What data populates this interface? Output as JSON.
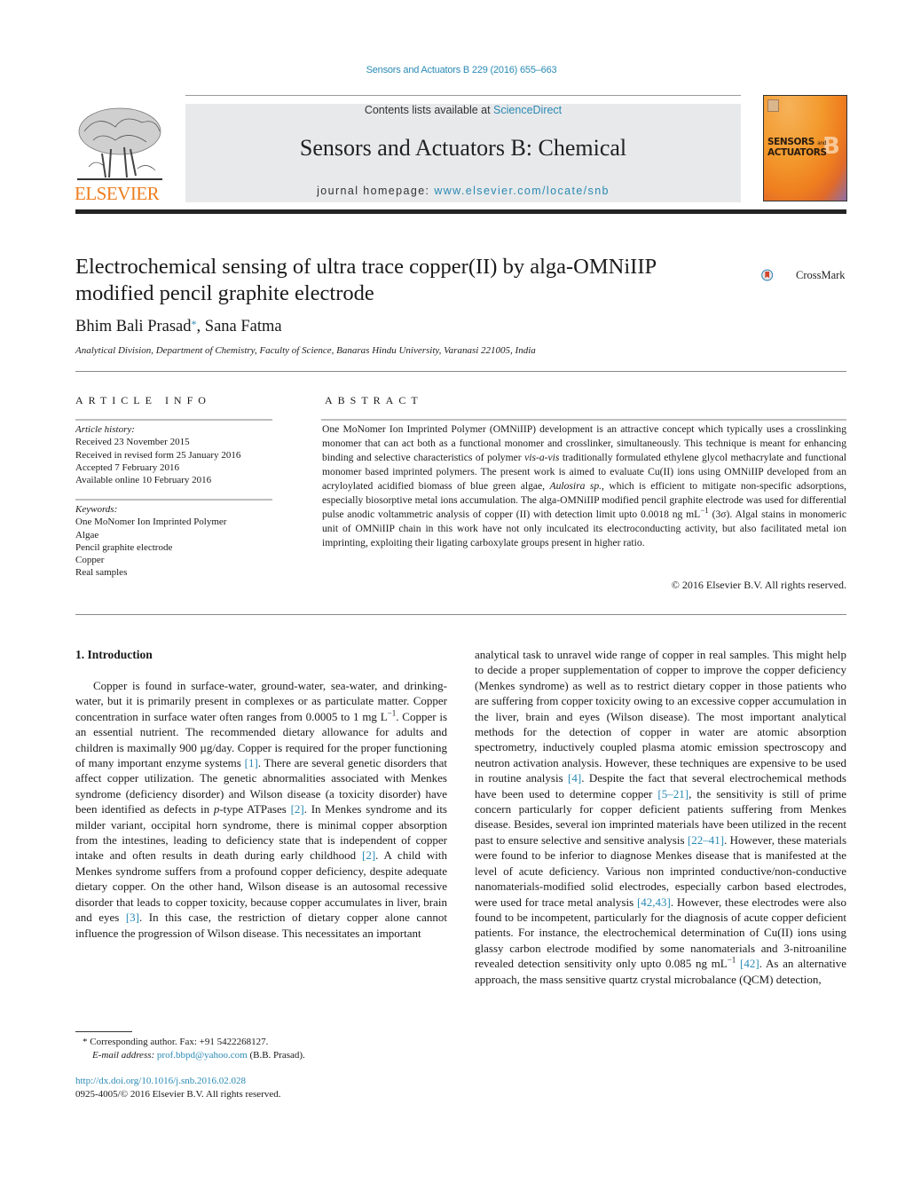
{
  "header": {
    "citation": "Sensors and Actuators B 229 (2016) 655–663",
    "contents_prefix": "Contents lists available at ",
    "contents_link": "ScienceDirect",
    "journal_title": "Sensors and Actuators B: Chemical",
    "homepage_prefix": "journal homepage: ",
    "homepage_link": "www.elsevier.com/locate/snb",
    "publisher_logo_text": "ELSEVIER",
    "cover_title_line1": "SENSORS",
    "cover_title_and": "and",
    "cover_title_line2": "ACTUATORS",
    "cover_letter": "B",
    "crossmark_label": "CrossMark"
  },
  "article": {
    "title": "Electrochemical sensing of ultra trace copper(II) by alga-OMNiIIP modified pencil graphite electrode",
    "authors": [
      {
        "name": "Bhim Bali Prasad",
        "corresponding_mark": "*"
      },
      {
        "name": "Sana Fatma"
      }
    ],
    "author_separator": ", ",
    "affiliation": "Analytical Division, Department of Chemistry, Faculty of Science, Banaras Hindu University, Varanasi 221005, India"
  },
  "article_info": {
    "heading": "ARTICLE INFO",
    "history_label": "Article history:",
    "history": [
      "Received 23 November 2015",
      "Received in revised form 25 January 2016",
      "Accepted 7 February 2016",
      "Available online 10 February 2016"
    ],
    "keywords_label": "Keywords:",
    "keywords": [
      "One MoNomer Ion Imprinted Polymer",
      "Algae",
      "Pencil graphite electrode",
      "Copper",
      "Real samples"
    ]
  },
  "abstract": {
    "heading": "ABSTRACT",
    "p1": "One MoNomer Ion Imprinted Polymer (OMNiIIP) development is an attractive concept which typically uses a crosslinking monomer that can act both as a functional monomer and crosslinker, simultaneously. This technique is meant for enhancing binding and selective characteristics of polymer ",
    "p1_italic": "vis-a-vis",
    "p2": " traditionally formulated ethylene glycol methacrylate and functional monomer based imprinted polymers. The present work is aimed to evaluate Cu(II) ions using OMNiIIP developed from an acryloylated acidified biomass of blue green algae, ",
    "p2_italic": "Aulosira sp.",
    "p3": ", which is efficient to mitigate non-specific adsorptions, especially biosorptive metal ions accumulation. The alga-OMNiIIP modified pencil graphite electrode was used for differential pulse anodic voltammetric analysis of copper (II) with detection limit upto 0.0018 ng mL",
    "p3_sup": "−1",
    "p4": " (3σ). Algal stains in monomeric unit of OMNiIIP chain in this work have not only inculcated its electroconducting activity, but also facilitated metal ion imprinting, exploiting their ligating carboxylate groups present in higher ratio.",
    "copyright": "© 2016 Elsevier B.V. All rights reserved."
  },
  "introduction": {
    "heading": "1.  Introduction",
    "left": [
      {
        "t": "Copper is found in surface-water, ground-water, sea-water, and drinking-water, but it is primarily present in complexes or as particulate matter. Copper concentration in surface water often ranges from 0.0005 to 1 mg L"
      },
      {
        "sup": "−1"
      },
      {
        "t": ". Copper is an essential nutrient. The recommended dietary allowance for adults and children is maximally 900 µg/day. Copper is required for the proper functioning of many important enzyme systems "
      },
      {
        "ref": "[1]"
      },
      {
        "t": ". There are several genetic disorders that affect copper utilization. The genetic abnormalities associated with Menkes syndrome (deficiency disorder) and Wilson disease (a toxicity disorder) have been identified as defects in "
      },
      {
        "it": "p"
      },
      {
        "t": "-type ATPases "
      },
      {
        "ref": "[2]"
      },
      {
        "t": ". In Menkes syndrome and its milder variant, occipital horn syndrome, there is minimal copper absorption from the intestines, leading to deficiency state that is independent of copper intake and often results in death during early childhood "
      },
      {
        "ref": "[2]"
      },
      {
        "t": ". A child with Menkes syndrome suffers from a profound copper deficiency, despite adequate dietary copper. On the other hand, Wilson disease is an autosomal recessive disorder that leads to copper toxicity, because copper accumulates in liver, brain and eyes "
      },
      {
        "ref": "[3]"
      },
      {
        "t": ". In this case, the restriction of dietary copper alone cannot influence the progression of Wilson disease. This necessitates an important"
      }
    ],
    "right": [
      {
        "t": "analytical task to unravel wide range of copper in real samples. This might help to decide a proper supplementation of copper to improve the copper deficiency (Menkes syndrome) as well as to restrict dietary copper in those patients who are suffering from copper toxicity owing to an excessive copper accumulation in the liver, brain and eyes (Wilson disease). The most important analytical methods for the detection of copper in water are atomic absorption spectrometry, inductively coupled plasma atomic emission spectroscopy and neutron activation analysis. However, these techniques are expensive to be used in routine analysis "
      },
      {
        "ref": "[4]"
      },
      {
        "t": ". Despite the fact that several electrochemical methods have been used to determine copper "
      },
      {
        "ref": "[5–21]"
      },
      {
        "t": ", the sensitivity is still of prime concern particularly for copper deficient patients suffering from Menkes disease. Besides, several ion imprinted materials have been utilized in the recent past to ensure selective and sensitive analysis "
      },
      {
        "ref": "[22–41]"
      },
      {
        "t": ". However, these materials were found to be inferior to diagnose Menkes disease that is manifested at the level of acute deficiency. Various non imprinted conductive/non-conductive nanomaterials-modified solid electrodes, especially carbon based electrodes, were used for trace metal analysis "
      },
      {
        "ref": "[42,43]"
      },
      {
        "t": ". However, these electrodes were also found to be incompetent, particularly for the diagnosis of acute copper deficient patients. For instance, the electrochemical determination of Cu(II) ions using glassy carbon electrode modified by some nanomaterials and 3-nitroaniline revealed detection sensitivity only upto 0.085 ng mL"
      },
      {
        "sup": "−1"
      },
      {
        "t": " "
      },
      {
        "ref": "[42]"
      },
      {
        "t": ". As an alternative approach, the mass sensitive quartz crystal microbalance (QCM) detection,"
      }
    ]
  },
  "footnote": {
    "mark": "*",
    "corresponding": " Corresponding author. Fax: +91 5422268127.",
    "email_label": "E-mail address:",
    "email": "prof.bbpd@yahoo.com",
    "email_suffix": " (B.B. Prasad).",
    "doi": "http://dx.doi.org/10.1016/j.snb.2016.02.028",
    "issn": "0925-4005/© 2016 Elsevier B.V. All rights reserved."
  },
  "colors": {
    "link": "#2a8ab5",
    "elsevier_orange": "#ee7d1f",
    "banner_grey": "#e8e9ea"
  }
}
